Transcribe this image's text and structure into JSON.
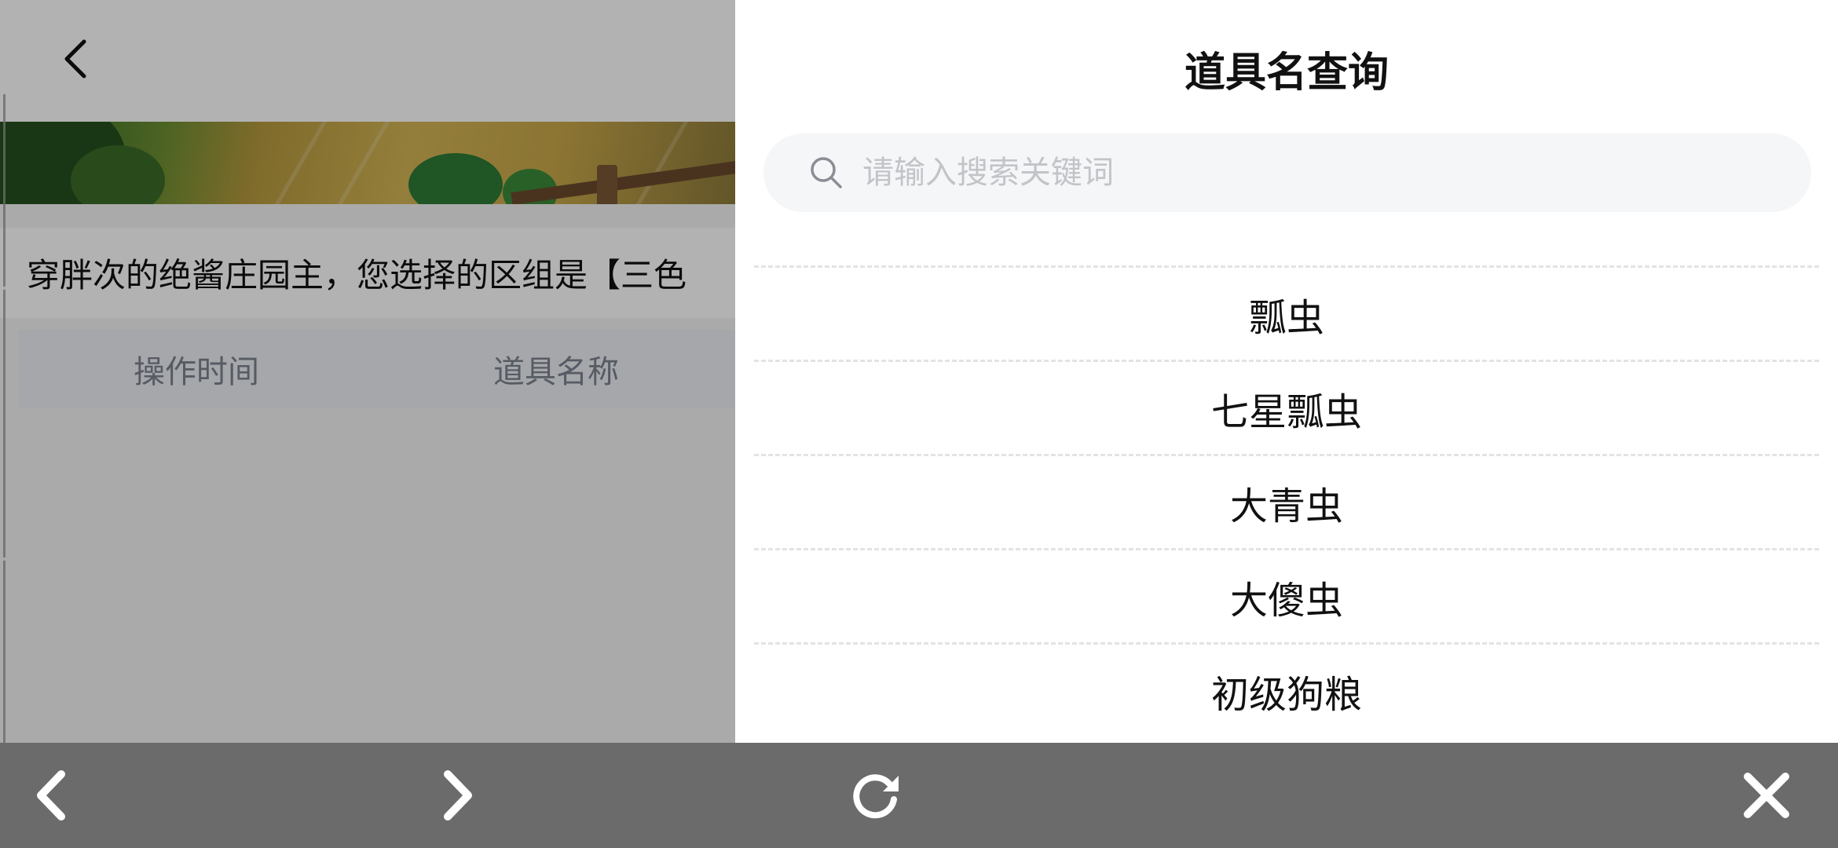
{
  "page": {
    "notice_text": "穿胖次的绝酱庄园主，您选择的区组是【三色",
    "table_headers": [
      "操作时间",
      "道具名称"
    ]
  },
  "drawer": {
    "title": "道具名查询",
    "search": {
      "placeholder": "请输入搜索关键词",
      "value": ""
    },
    "results": [
      "瓢虫",
      "七星瓢虫",
      "大青虫",
      "大傻虫",
      "初级狗粮"
    ]
  },
  "icons": {
    "header_back": "chevron-left-icon",
    "search": "search-icon",
    "toolbar": [
      "back-arrow-icon",
      "forward-arrow-icon",
      "refresh-icon",
      "close-icon"
    ]
  },
  "colors": {
    "overlay_dim": "#000000",
    "toolbar_bg": "#6b6b6b",
    "search_bg": "#f5f6f8",
    "placeholder": "#c2c4c8"
  }
}
